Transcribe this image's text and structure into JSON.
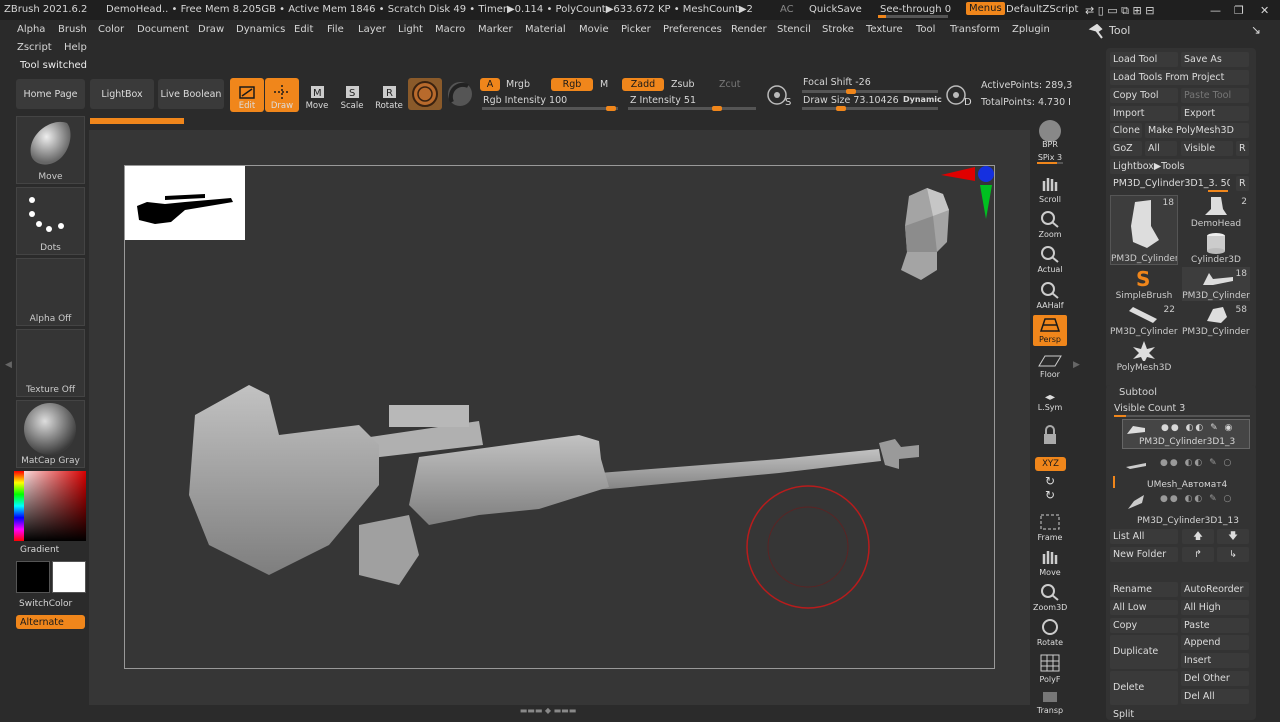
{
  "titlebar": {
    "app": "ZBrush 2021.6.2",
    "doc": "DemoHead",
    "stats": ".. • Free Mem 8.205GB • Active Mem 1846 • Scratch Disk 49 • Timer▶0.114 • PolyCount▶633.672 KP • MeshCount▶2",
    "ac": "AC",
    "quicksave": "QuickSave",
    "seethrough": "See-through  0",
    "menus": "Menus",
    "zscript": "DefaultZScript"
  },
  "menu": [
    "Alpha",
    "Brush",
    "Color",
    "Document",
    "Draw",
    "Dynamics",
    "Edit",
    "File",
    "Layer",
    "Light",
    "Macro",
    "Marker",
    "Material",
    "Movie",
    "Picker",
    "Preferences",
    "Render",
    "Stencil",
    "Stroke",
    "Texture",
    "Tool",
    "Transform",
    "Zplugin"
  ],
  "menu2": [
    "Zscript",
    "Help"
  ],
  "status": "Tool switched",
  "shelf": {
    "home": "Home Page",
    "lightbox": "LightBox",
    "liveboolean": "Live Boolean",
    "edit": "Edit",
    "draw": "Draw",
    "move": "Move",
    "scale": "Scale",
    "rotate": "Rotate",
    "a": "A",
    "mrgb": "Mrgb",
    "rgb": "Rgb",
    "m": "M",
    "zadd": "Zadd",
    "zsub": "Zsub",
    "zcut": "Zcut",
    "rgbint": "Rgb Intensity 100",
    "zint": "Z Intensity 51",
    "focal": "Focal Shift -26",
    "drawsize": "Draw Size 73.10426",
    "dynamic": "Dynamic",
    "activepts": "ActivePoints: 289,3",
    "totalpts": "TotalPoints: 4.730 I",
    "s": "S",
    "d": "D"
  },
  "left": {
    "brush": "Move",
    "stroke": "Dots",
    "alpha": "Alpha Off",
    "texture": "Texture Off",
    "material": "MatCap Gray",
    "gradient": "Gradient",
    "switchcolor": "SwitchColor",
    "alternate": "Alternate"
  },
  "righticons": [
    "BPR",
    "SPix 3",
    "Scroll",
    "Zoom",
    "Actual",
    "AAHalf",
    "Persp",
    "Floor",
    "L.Sym",
    "",
    "XYZ",
    "",
    "",
    "Frame",
    "Move",
    "Zoom3D",
    "Rotate",
    "PolyF",
    "Transp"
  ],
  "tool": {
    "title": "Tool",
    "loadtool": "Load Tool",
    "saveas": "Save As",
    "loadproj": "Load Tools From Project",
    "copytool": "Copy Tool",
    "pastetool": "Paste Tool",
    "import": "Import",
    "export": "Export",
    "clone": "Clone",
    "makepoly": "Make PolyMesh3D",
    "goz": "GoZ",
    "all": "All",
    "visible": "Visible",
    "r": "R",
    "lightbox": "Lightbox▶Tools",
    "current": "PM3D_Cylinder3D1_3. 50",
    "r2": "R",
    "thumbs": [
      {
        "label": "PM3D_Cylinder",
        "num": "18"
      },
      {
        "label": "DemoHead",
        "num": "2"
      },
      {
        "label": "Cylinder3D",
        "num": ""
      },
      {
        "label": "SimpleBrush",
        "num": ""
      },
      {
        "label": "PM3D_Cylinder",
        "num": "18"
      },
      {
        "label": "PM3D_Cylinder:",
        "num": "22"
      },
      {
        "label": "PM3D_Cylinder:",
        "num": "58"
      },
      {
        "label": "PolyMesh3D",
        "num": ""
      }
    ]
  },
  "subtool": {
    "title": "Subtool",
    "visiblecount": "Visible Count 3",
    "items": [
      "PM3D_Cylinder3D1_3",
      "UMesh_Автомат4",
      "PM3D_Cylinder3D1_13"
    ],
    "listall": "List All",
    "newfolder": "New Folder",
    "rename": "Rename",
    "autoreorder": "AutoReorder",
    "alllow": "All Low",
    "allhigh": "All High",
    "copy": "Copy",
    "paste": "Paste",
    "append": "Append",
    "duplicate": "Duplicate",
    "insert": "Insert",
    "delete": "Delete",
    "delother": "Del Other",
    "delall": "Del All",
    "split": "Split"
  },
  "colors": {
    "accent": "#f0861b",
    "bg": "#2b2b2b",
    "canvas": "#363636"
  }
}
